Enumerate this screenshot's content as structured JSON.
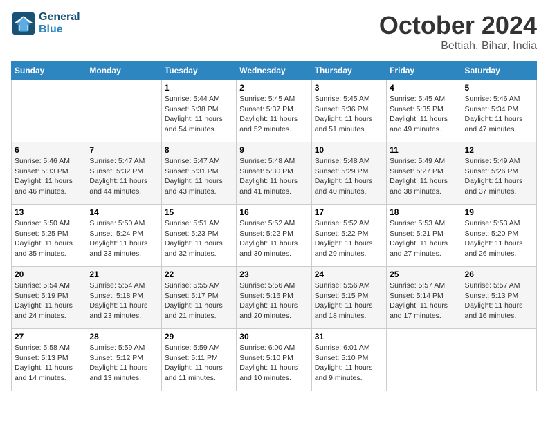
{
  "header": {
    "logo_line1": "General",
    "logo_line2": "Blue",
    "month": "October 2024",
    "location": "Bettiah, Bihar, India"
  },
  "weekdays": [
    "Sunday",
    "Monday",
    "Tuesday",
    "Wednesday",
    "Thursday",
    "Friday",
    "Saturday"
  ],
  "weeks": [
    [
      {
        "day": "",
        "sunrise": "",
        "sunset": "",
        "daylight": ""
      },
      {
        "day": "",
        "sunrise": "",
        "sunset": "",
        "daylight": ""
      },
      {
        "day": "1",
        "sunrise": "Sunrise: 5:44 AM",
        "sunset": "Sunset: 5:38 PM",
        "daylight": "Daylight: 11 hours and 54 minutes."
      },
      {
        "day": "2",
        "sunrise": "Sunrise: 5:45 AM",
        "sunset": "Sunset: 5:37 PM",
        "daylight": "Daylight: 11 hours and 52 minutes."
      },
      {
        "day": "3",
        "sunrise": "Sunrise: 5:45 AM",
        "sunset": "Sunset: 5:36 PM",
        "daylight": "Daylight: 11 hours and 51 minutes."
      },
      {
        "day": "4",
        "sunrise": "Sunrise: 5:45 AM",
        "sunset": "Sunset: 5:35 PM",
        "daylight": "Daylight: 11 hours and 49 minutes."
      },
      {
        "day": "5",
        "sunrise": "Sunrise: 5:46 AM",
        "sunset": "Sunset: 5:34 PM",
        "daylight": "Daylight: 11 hours and 47 minutes."
      }
    ],
    [
      {
        "day": "6",
        "sunrise": "Sunrise: 5:46 AM",
        "sunset": "Sunset: 5:33 PM",
        "daylight": "Daylight: 11 hours and 46 minutes."
      },
      {
        "day": "7",
        "sunrise": "Sunrise: 5:47 AM",
        "sunset": "Sunset: 5:32 PM",
        "daylight": "Daylight: 11 hours and 44 minutes."
      },
      {
        "day": "8",
        "sunrise": "Sunrise: 5:47 AM",
        "sunset": "Sunset: 5:31 PM",
        "daylight": "Daylight: 11 hours and 43 minutes."
      },
      {
        "day": "9",
        "sunrise": "Sunrise: 5:48 AM",
        "sunset": "Sunset: 5:30 PM",
        "daylight": "Daylight: 11 hours and 41 minutes."
      },
      {
        "day": "10",
        "sunrise": "Sunrise: 5:48 AM",
        "sunset": "Sunset: 5:29 PM",
        "daylight": "Daylight: 11 hours and 40 minutes."
      },
      {
        "day": "11",
        "sunrise": "Sunrise: 5:49 AM",
        "sunset": "Sunset: 5:27 PM",
        "daylight": "Daylight: 11 hours and 38 minutes."
      },
      {
        "day": "12",
        "sunrise": "Sunrise: 5:49 AM",
        "sunset": "Sunset: 5:26 PM",
        "daylight": "Daylight: 11 hours and 37 minutes."
      }
    ],
    [
      {
        "day": "13",
        "sunrise": "Sunrise: 5:50 AM",
        "sunset": "Sunset: 5:25 PM",
        "daylight": "Daylight: 11 hours and 35 minutes."
      },
      {
        "day": "14",
        "sunrise": "Sunrise: 5:50 AM",
        "sunset": "Sunset: 5:24 PM",
        "daylight": "Daylight: 11 hours and 33 minutes."
      },
      {
        "day": "15",
        "sunrise": "Sunrise: 5:51 AM",
        "sunset": "Sunset: 5:23 PM",
        "daylight": "Daylight: 11 hours and 32 minutes."
      },
      {
        "day": "16",
        "sunrise": "Sunrise: 5:52 AM",
        "sunset": "Sunset: 5:22 PM",
        "daylight": "Daylight: 11 hours and 30 minutes."
      },
      {
        "day": "17",
        "sunrise": "Sunrise: 5:52 AM",
        "sunset": "Sunset: 5:22 PM",
        "daylight": "Daylight: 11 hours and 29 minutes."
      },
      {
        "day": "18",
        "sunrise": "Sunrise: 5:53 AM",
        "sunset": "Sunset: 5:21 PM",
        "daylight": "Daylight: 11 hours and 27 minutes."
      },
      {
        "day": "19",
        "sunrise": "Sunrise: 5:53 AM",
        "sunset": "Sunset: 5:20 PM",
        "daylight": "Daylight: 11 hours and 26 minutes."
      }
    ],
    [
      {
        "day": "20",
        "sunrise": "Sunrise: 5:54 AM",
        "sunset": "Sunset: 5:19 PM",
        "daylight": "Daylight: 11 hours and 24 minutes."
      },
      {
        "day": "21",
        "sunrise": "Sunrise: 5:54 AM",
        "sunset": "Sunset: 5:18 PM",
        "daylight": "Daylight: 11 hours and 23 minutes."
      },
      {
        "day": "22",
        "sunrise": "Sunrise: 5:55 AM",
        "sunset": "Sunset: 5:17 PM",
        "daylight": "Daylight: 11 hours and 21 minutes."
      },
      {
        "day": "23",
        "sunrise": "Sunrise: 5:56 AM",
        "sunset": "Sunset: 5:16 PM",
        "daylight": "Daylight: 11 hours and 20 minutes."
      },
      {
        "day": "24",
        "sunrise": "Sunrise: 5:56 AM",
        "sunset": "Sunset: 5:15 PM",
        "daylight": "Daylight: 11 hours and 18 minutes."
      },
      {
        "day": "25",
        "sunrise": "Sunrise: 5:57 AM",
        "sunset": "Sunset: 5:14 PM",
        "daylight": "Daylight: 11 hours and 17 minutes."
      },
      {
        "day": "26",
        "sunrise": "Sunrise: 5:57 AM",
        "sunset": "Sunset: 5:13 PM",
        "daylight": "Daylight: 11 hours and 16 minutes."
      }
    ],
    [
      {
        "day": "27",
        "sunrise": "Sunrise: 5:58 AM",
        "sunset": "Sunset: 5:13 PM",
        "daylight": "Daylight: 11 hours and 14 minutes."
      },
      {
        "day": "28",
        "sunrise": "Sunrise: 5:59 AM",
        "sunset": "Sunset: 5:12 PM",
        "daylight": "Daylight: 11 hours and 13 minutes."
      },
      {
        "day": "29",
        "sunrise": "Sunrise: 5:59 AM",
        "sunset": "Sunset: 5:11 PM",
        "daylight": "Daylight: 11 hours and 11 minutes."
      },
      {
        "day": "30",
        "sunrise": "Sunrise: 6:00 AM",
        "sunset": "Sunset: 5:10 PM",
        "daylight": "Daylight: 11 hours and 10 minutes."
      },
      {
        "day": "31",
        "sunrise": "Sunrise: 6:01 AM",
        "sunset": "Sunset: 5:10 PM",
        "daylight": "Daylight: 11 hours and 9 minutes."
      },
      {
        "day": "",
        "sunrise": "",
        "sunset": "",
        "daylight": ""
      },
      {
        "day": "",
        "sunrise": "",
        "sunset": "",
        "daylight": ""
      }
    ]
  ]
}
